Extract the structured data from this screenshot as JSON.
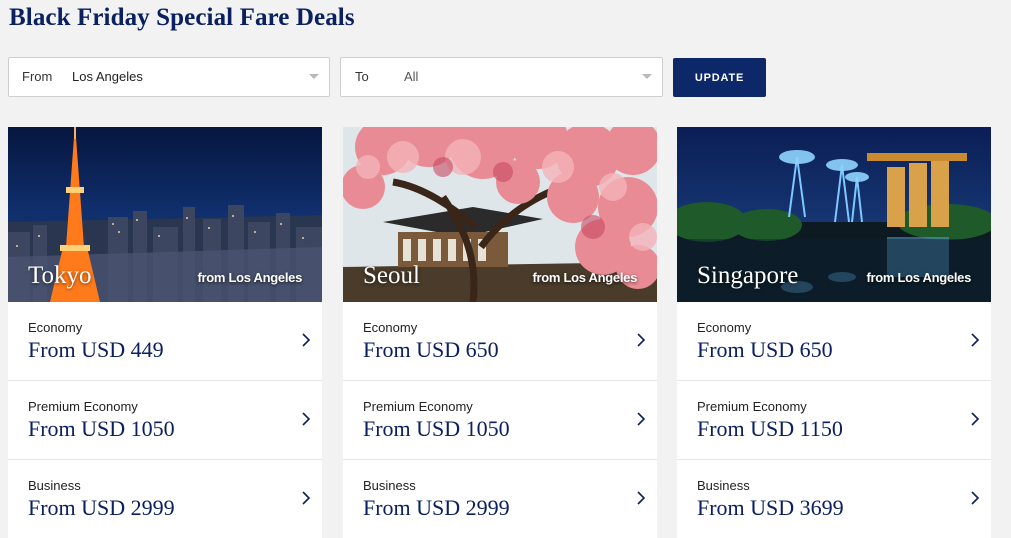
{
  "page": {
    "title": "Black Friday Special Fare Deals"
  },
  "filters": {
    "from_label": "From",
    "from_value": "Los Angeles",
    "to_label": "To",
    "to_value": "All",
    "update_label": "UPDATE"
  },
  "colors": {
    "brand": "#0d2868",
    "price_text": "#0a2060"
  },
  "cards": [
    {
      "city": "Tokyo",
      "origin": "from Los Angeles",
      "fares": [
        {
          "cabin": "Economy",
          "price": "From USD 449"
        },
        {
          "cabin": "Premium Economy",
          "price": "From USD 1050"
        },
        {
          "cabin": "Business",
          "price": "From USD 2999"
        }
      ]
    },
    {
      "city": "Seoul",
      "origin": "from Los Angeles",
      "fares": [
        {
          "cabin": "Economy",
          "price": "From USD 650"
        },
        {
          "cabin": "Premium Economy",
          "price": "From USD 1050"
        },
        {
          "cabin": "Business",
          "price": "From USD 2999"
        }
      ]
    },
    {
      "city": "Singapore",
      "origin": "from Los Angeles",
      "fares": [
        {
          "cabin": "Economy",
          "price": "From USD 650"
        },
        {
          "cabin": "Premium Economy",
          "price": "From USD 1150"
        },
        {
          "cabin": "Business",
          "price": "From USD 3699"
        }
      ]
    }
  ]
}
